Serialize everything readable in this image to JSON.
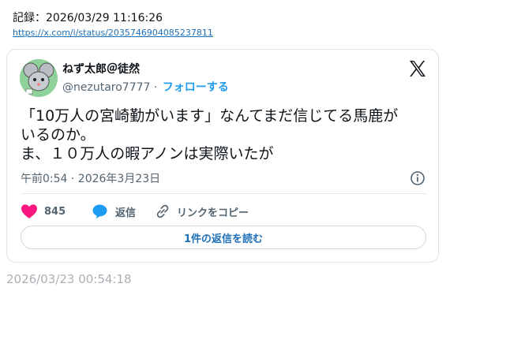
{
  "record": {
    "label": "記録：2026/03/29 11:16:26",
    "link": "https://x.com/i/status/2035746904085237811"
  },
  "tweet": {
    "display_name": "ねず太郎＠徒然",
    "handle": "@nezutaro7777",
    "separator": "·",
    "follow_label": "フォローする",
    "text_lines": [
      "「10万人の宮崎勤がいます」なんてまだ信じてる馬鹿が",
      "いるのか。",
      "ま、１０万人の暇アノンは実際いたが"
    ],
    "timestamp": "午前0:54 · 2026年3月23日",
    "actions": {
      "like_count": "845",
      "reply_label": "返信",
      "copy_link_label": "リンクをコピー"
    },
    "read_replies_label": "1件の返信を読む",
    "icons": [
      "avatar",
      "x-logo-icon",
      "info-icon",
      "heart-icon",
      "reply-bubble-icon",
      "link-icon"
    ]
  },
  "capture_time": "2026/03/23 00:54:18",
  "colors": {
    "heart": "#f91880",
    "reply": "#1d9bf0",
    "follow": "#1d9bf0",
    "link": "#1d6fb8"
  }
}
